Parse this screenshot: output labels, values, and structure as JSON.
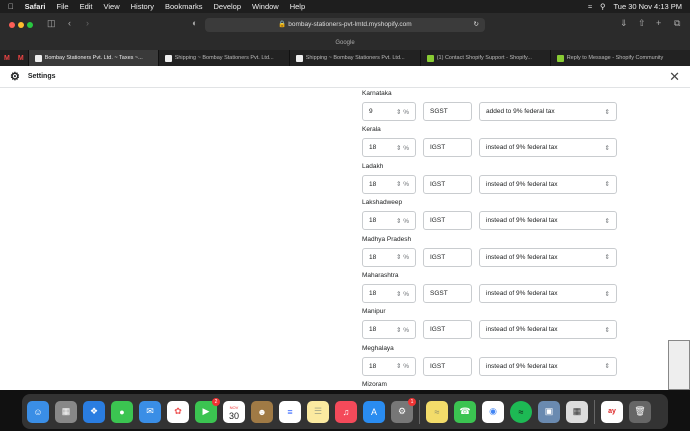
{
  "menubar": {
    "app": "Safari",
    "items": [
      "File",
      "Edit",
      "View",
      "History",
      "Bookmarks",
      "Develop",
      "Window",
      "Help"
    ],
    "clock": "Tue 30 Nov  4:13 PM"
  },
  "browser": {
    "url": "bombay-stationers-pvt-lmtd.myshopify.com",
    "favorites_label": "Google",
    "tabs": [
      "Bombay Stationers Pvt. Ltd. ~ Taxes ~...",
      "Shipping ~ Bombay Stationers Pvt. Ltd...",
      "Shipping ~ Bombay Stationers Pvt. Ltd...",
      "(1) Contact Shopify Support - Shopify...",
      "Reply to Message - Shopify Community"
    ]
  },
  "header": {
    "title": "Settings"
  },
  "regions": [
    {
      "name": "Karnataka",
      "rate": "9",
      "code": "SGST",
      "mode": "added to 9% federal tax"
    },
    {
      "name": "Kerala",
      "rate": "18",
      "code": "IGST",
      "mode": "instead of 9% federal tax"
    },
    {
      "name": "Ladakh",
      "rate": "18",
      "code": "IGST",
      "mode": "instead of 9% federal tax"
    },
    {
      "name": "Lakshadweep",
      "rate": "18",
      "code": "IGST",
      "mode": "instead of 9% federal tax"
    },
    {
      "name": "Madhya Pradesh",
      "rate": "18",
      "code": "IGST",
      "mode": "instead of 9% federal tax"
    },
    {
      "name": "Maharashtra",
      "rate": "18",
      "code": "SGST",
      "mode": "instead of 9% federal tax"
    },
    {
      "name": "Manipur",
      "rate": "18",
      "code": "IGST",
      "mode": "instead of 9% federal tax"
    },
    {
      "name": "Meghalaya",
      "rate": "18",
      "code": "IGST",
      "mode": "instead of 9% federal tax"
    },
    {
      "name": "Mizoram",
      "rate": "",
      "code": "",
      "mode": ""
    }
  ],
  "percent": "%",
  "dock": {
    "calendar_month": "NOV",
    "calendar_day": "30",
    "facetime_badge": "2",
    "settings_badge": "1"
  }
}
